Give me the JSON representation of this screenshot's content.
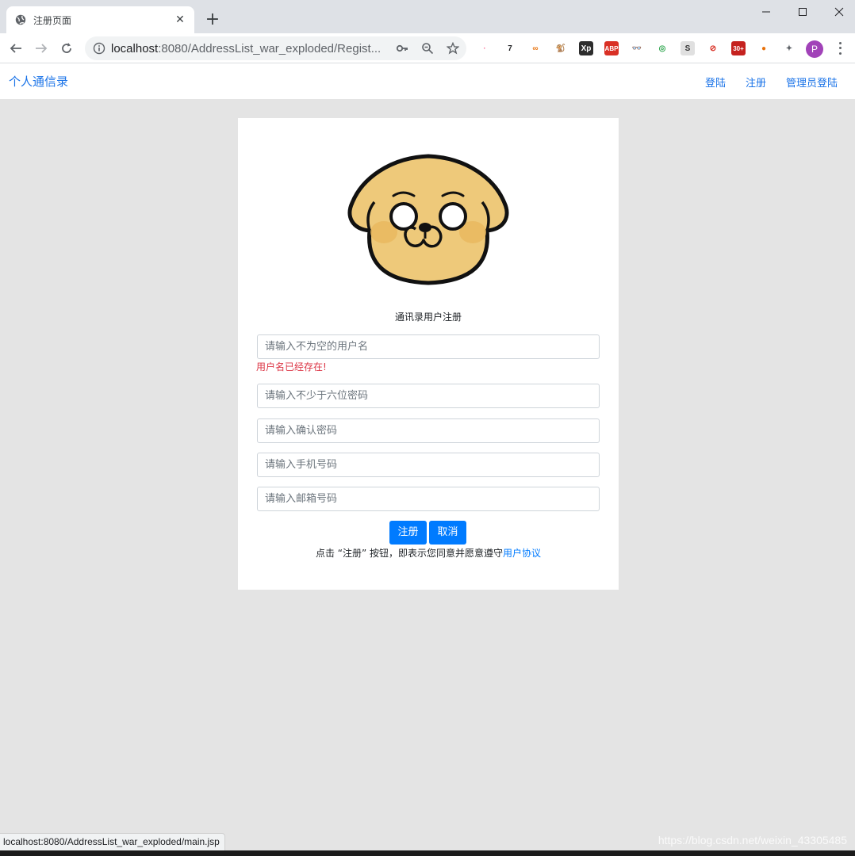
{
  "browser": {
    "tab_title": "注册页面",
    "tab_close": "✕",
    "new_tab": "+",
    "url_host": "localhost",
    "url_rest": ":8080/AddressList_war_exploded/Regist...",
    "extensions": [
      {
        "name": "ext-bilibili-icon",
        "glyph": "·",
        "bg": "#ffffff",
        "fg": "#fb7299"
      },
      {
        "name": "ext-seven-icon",
        "glyph": "7",
        "bg": "#ffffff",
        "fg": "#202124"
      },
      {
        "name": "ext-infinity-icon",
        "glyph": "∞",
        "bg": "#ffffff",
        "fg": "#e8710a"
      },
      {
        "name": "ext-tampermonkey-icon",
        "glyph": "🐒",
        "bg": "#ffffff",
        "fg": "#c79a00"
      },
      {
        "name": "ext-xpath-icon",
        "glyph": "Xp",
        "bg": "#2d2d2d",
        "fg": "#ffffff"
      },
      {
        "name": "ext-adblock-icon",
        "glyph": "ABP",
        "bg": "#d93025",
        "fg": "#ffffff"
      },
      {
        "name": "ext-glasses-icon",
        "glyph": "👓",
        "bg": "#ffffff",
        "fg": "#1a73e8"
      },
      {
        "name": "ext-color-icon",
        "glyph": "◎",
        "bg": "#ffffff",
        "fg": "#34a853"
      },
      {
        "name": "ext-s-icon",
        "glyph": "S",
        "bg": "#e0e0e0",
        "fg": "#333333"
      },
      {
        "name": "ext-block-icon",
        "glyph": "⊘",
        "bg": "#ffffff",
        "fg": "#d93025"
      },
      {
        "name": "ext-badge-icon",
        "glyph": "30+",
        "bg": "#c5221f",
        "fg": "#ffffff"
      },
      {
        "name": "ext-orange-icon",
        "glyph": "●",
        "bg": "#ffffff",
        "fg": "#e8710a"
      },
      {
        "name": "extensions-puzzle-icon",
        "glyph": "✦",
        "bg": "#ffffff",
        "fg": "#5f6368"
      }
    ],
    "profile_initial": "P"
  },
  "navbar": {
    "brand": "个人通信录",
    "links": [
      "登陆",
      "注册",
      "管理员登陆"
    ]
  },
  "form": {
    "title": "通讯录用户注册",
    "username_placeholder": "请输入不为空的用户名",
    "username_error": "用户名已经存在!",
    "password_placeholder": "请输入不少于六位密码",
    "confirm_placeholder": "请输入确认密码",
    "phone_placeholder": "请输入手机号码",
    "email_placeholder": "请输入邮箱号码",
    "register_label": "注册",
    "cancel_label": "取消",
    "agree_text": "点击 “注册” 按钮，即表示您同意并愿意遵守",
    "agree_link": "用户协议"
  },
  "status": {
    "url": "localhost:8080/AddressList_war_exploded/main.jsp",
    "watermark": "https://blog.csdn.net/weixin_43305485"
  },
  "colors": {
    "accent": "#007bff",
    "error": "#dc3545",
    "link": "#1a73e8"
  }
}
